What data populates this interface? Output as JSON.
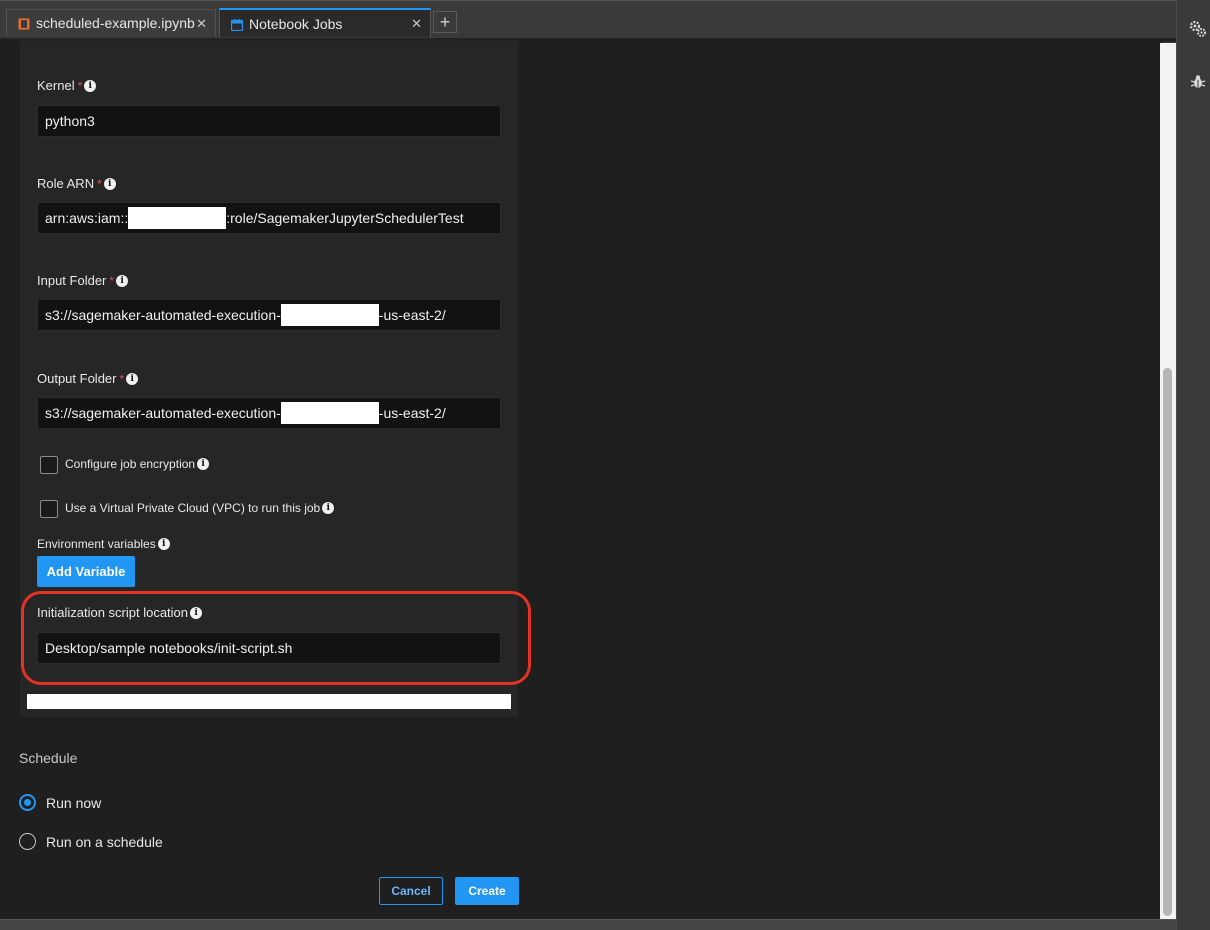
{
  "tabs": [
    {
      "label": "scheduled-example.ipynb",
      "icon": "notebook-icon",
      "active": false
    },
    {
      "label": "Notebook Jobs",
      "icon": "calendar-icon",
      "active": true
    }
  ],
  "add_tab_label": "+",
  "close_glyph": "✕",
  "form": {
    "kernel": {
      "label": "Kernel",
      "required": "*",
      "value": "python3"
    },
    "role_arn": {
      "label": "Role ARN",
      "required": "*",
      "value_prefix": "arn:aws:iam::",
      "value_suffix": ":role/SagemakerJupyterSchedulerTest"
    },
    "input_folder": {
      "label": "Input Folder",
      "required": "*",
      "value_prefix": "s3://sagemaker-automated-execution-",
      "value_suffix": "-us-east-2/"
    },
    "output_folder": {
      "label": "Output Folder",
      "required": "*",
      "value_prefix": "s3://sagemaker-automated-execution-",
      "value_suffix": "-us-east-2/"
    },
    "configure_encryption_label": "Configure job encryption",
    "use_vpc_label": "Use a Virtual Private Cloud (VPC) to run this job",
    "env_vars_label": "Environment variables",
    "add_variable_label": "Add Variable",
    "init_script": {
      "label": "Initialization script location",
      "value": "Desktop/sample notebooks/init-script.sh"
    }
  },
  "schedule": {
    "title": "Schedule",
    "options": [
      {
        "label": "Run now",
        "selected": true
      },
      {
        "label": "Run on a schedule",
        "selected": false
      }
    ]
  },
  "actions": {
    "cancel_label": "Cancel",
    "create_label": "Create"
  },
  "colors": {
    "accent": "#2196f3",
    "highlight": "#e53224",
    "required": "#e65050"
  }
}
